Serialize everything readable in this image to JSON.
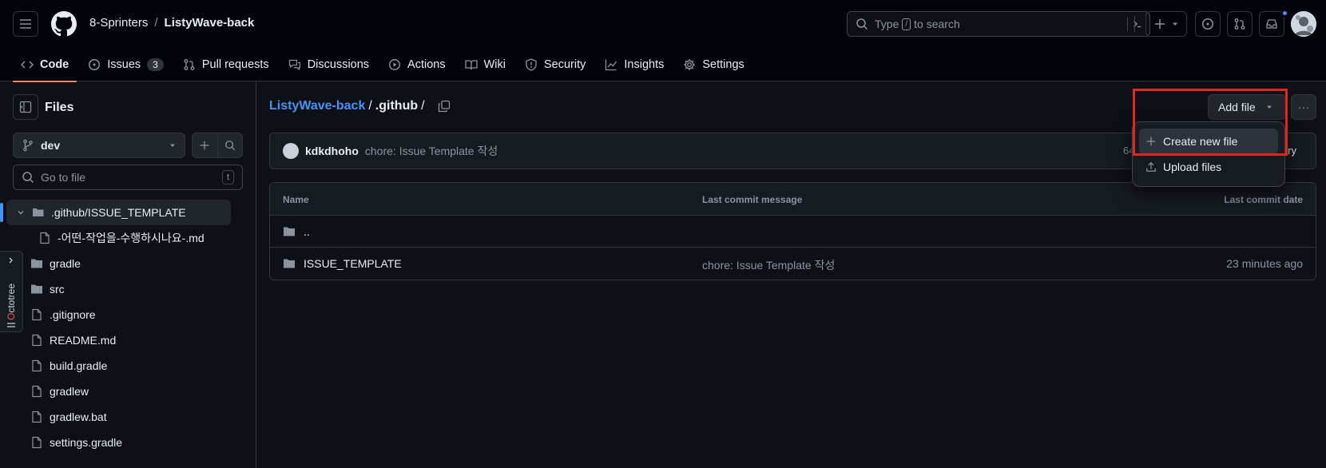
{
  "header": {
    "owner": "8-Sprinters",
    "separator": "/",
    "repo": "ListyWave-back",
    "search_prefix": "Type",
    "search_key": "/",
    "search_suffix": "to search"
  },
  "nav": {
    "tabs": [
      {
        "label": "Code",
        "icon": "code-icon",
        "active": true
      },
      {
        "label": "Issues",
        "icon": "issue-icon",
        "count": "3"
      },
      {
        "label": "Pull requests",
        "icon": "pull-request-icon"
      },
      {
        "label": "Discussions",
        "icon": "discussions-icon"
      },
      {
        "label": "Actions",
        "icon": "play-icon"
      },
      {
        "label": "Wiki",
        "icon": "book-icon"
      },
      {
        "label": "Security",
        "icon": "shield-icon"
      },
      {
        "label": "Insights",
        "icon": "graph-icon"
      },
      {
        "label": "Settings",
        "icon": "gear-icon"
      }
    ]
  },
  "sidebar": {
    "title": "Files",
    "branch": "dev",
    "goto_placeholder": "Go to file",
    "goto_key": "t",
    "tree": [
      {
        "label": ".github/ISSUE_TEMPLATE",
        "type": "dir-open"
      },
      {
        "label": "-어떤-작업을-수행하시나요-.md",
        "type": "file"
      },
      {
        "label": "gradle",
        "type": "dir"
      },
      {
        "label": "src",
        "type": "dir"
      },
      {
        "label": ".gitignore",
        "type": "file"
      },
      {
        "label": "README.md",
        "type": "file"
      },
      {
        "label": "build.gradle",
        "type": "file"
      },
      {
        "label": "gradlew",
        "type": "file"
      },
      {
        "label": "gradlew.bat",
        "type": "file"
      },
      {
        "label": "settings.gradle",
        "type": "file"
      }
    ]
  },
  "octotree": {
    "first": "O",
    "rest": "ctotree"
  },
  "breadcrumb": {
    "repo": "ListyWave-back",
    "sep1": "/",
    "dir": ".github",
    "sep2": "/"
  },
  "actions": {
    "add_file": "Add file",
    "more": "···"
  },
  "dropdown": {
    "create": "Create new file",
    "upload": "Upload files"
  },
  "commit": {
    "author": "kdkdhoho",
    "message": "chore: Issue Template 작성",
    "truncated_hash": "64",
    "truncated_history": "ry"
  },
  "table": {
    "headers": {
      "name": "Name",
      "message": "Last commit message",
      "date": "Last commit date"
    },
    "rows": [
      {
        "name": "..",
        "message": "",
        "date": ""
      },
      {
        "name": "ISSUE_TEMPLATE",
        "message": "chore: Issue Template 작성",
        "date": "23 minutes ago"
      }
    ]
  },
  "colors": {
    "accent": "#4493f8",
    "active_tab": "#f78166",
    "highlight": "#e5251c"
  }
}
